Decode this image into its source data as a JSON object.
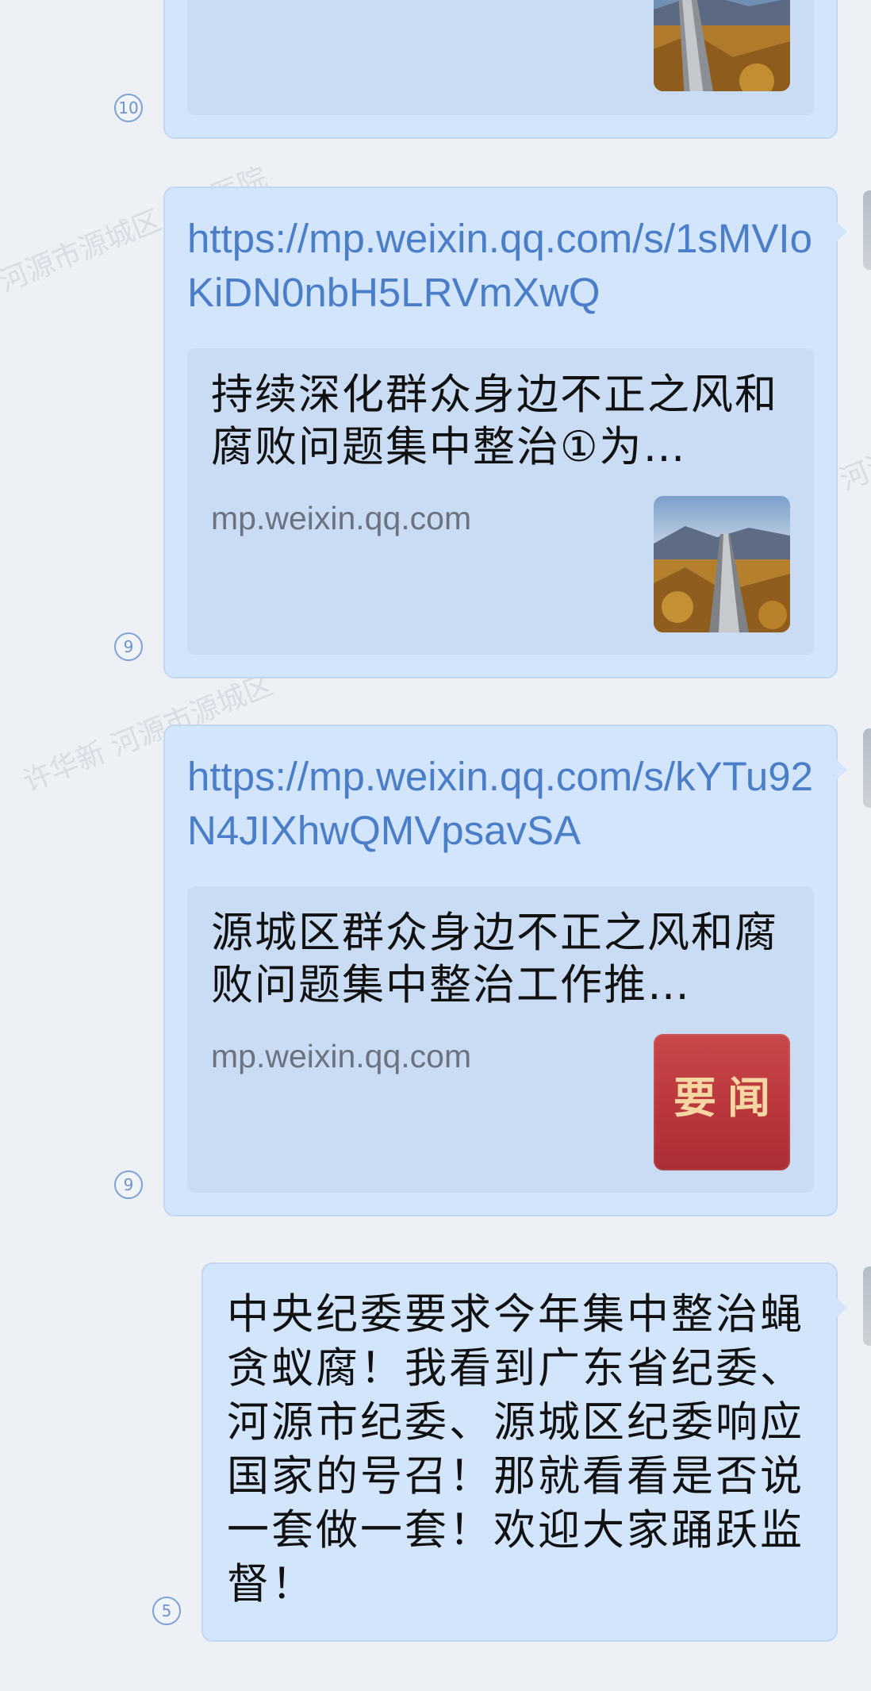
{
  "watermark": {
    "text_a": "河源市源城区人民医院",
    "text_b": "许华新  河源市源城区"
  },
  "messages": [
    {
      "type": "link",
      "read_count": "10",
      "thumbnail": "great-wall-image"
    },
    {
      "type": "link",
      "url": "https://mp.weixin.qq.com/s/1sMVIoKiDN0nbH5LRVmXwQ",
      "card_title": "持续深化群众身边不正之风和腐败问题集中整治①为…",
      "card_domain": "mp.weixin.qq.com",
      "thumbnail": "great-wall-image",
      "read_count": "9"
    },
    {
      "type": "link",
      "url": "https://mp.weixin.qq.com/s/kYTu92N4JIXhwQMVpsavSA",
      "card_title": "源城区群众身边不正之风和腐败问题集中整治工作推…",
      "card_domain": "mp.weixin.qq.com",
      "thumbnail": "news-badge",
      "thumbnail_text": "要闻",
      "read_count": "9"
    },
    {
      "type": "text",
      "text": "中央纪委要求今年集中整治蝇贪蚁腐！我看到广东省纪委、河源市纪委、源城区纪委响应国家的号召！那就看看是否说一套做一套！欢迎大家踊跃监督！",
      "read_count": "5"
    }
  ],
  "colors": {
    "background": "#edf0f5",
    "bubble": "#d3e5fb",
    "card": "#c9dcf3",
    "link": "#4a7ec8",
    "news_red": "#b8363b",
    "news_gold": "#f6d7a3"
  }
}
